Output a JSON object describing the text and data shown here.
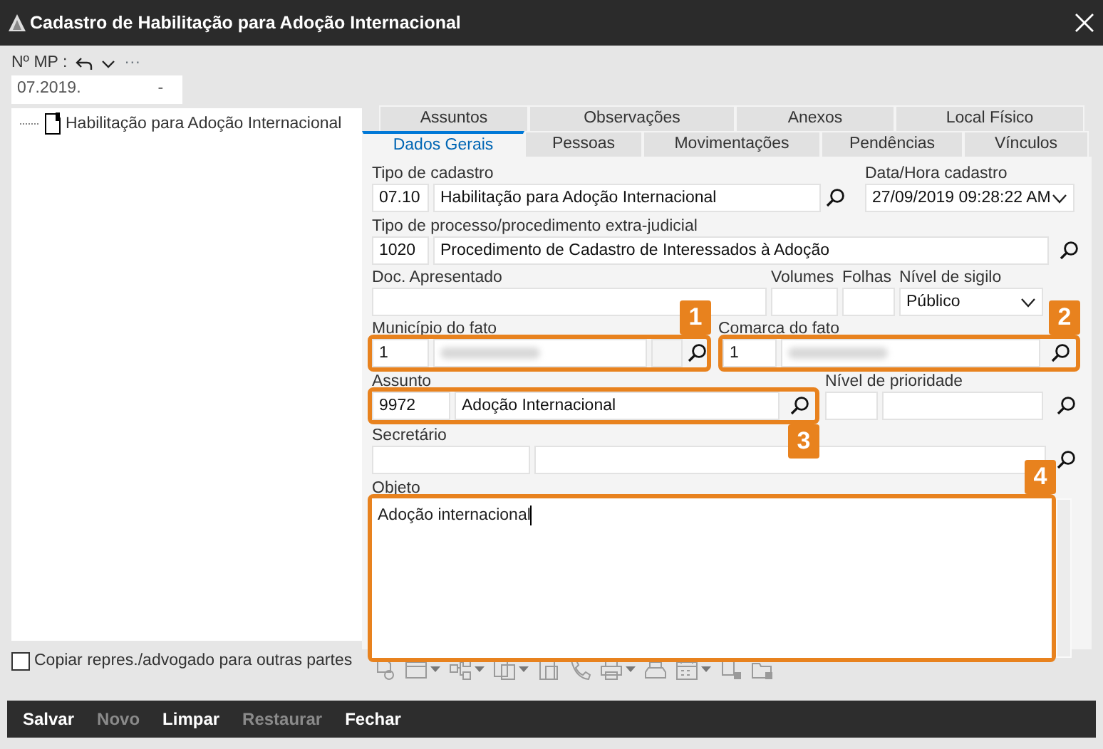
{
  "window": {
    "title": "Cadastro de Habilitação para Adoção Internacional"
  },
  "mp": {
    "label": "Nº MP :",
    "value": "07.2019.",
    "suffix": "-",
    "more": "···"
  },
  "tree": [
    {
      "label": "Habilitação para Adoção Internacional"
    }
  ],
  "copy_option": {
    "label": "Copiar repres./advogado para outras partes",
    "checked": false
  },
  "tabs": [
    [
      {
        "label": "Assuntos",
        "selected": false
      },
      {
        "label": "Observações",
        "selected": false
      },
      {
        "label": "Anexos",
        "selected": false
      },
      {
        "label": "Local Físico",
        "selected": false
      }
    ],
    [
      {
        "label": "Dados Gerais",
        "selected": true
      },
      {
        "label": "Pessoas",
        "selected": false
      },
      {
        "label": "Movimentações",
        "selected": false
      },
      {
        "label": "Pendências",
        "selected": false
      },
      {
        "label": "Vínculos",
        "selected": false
      }
    ]
  ],
  "form": {
    "tipo_cadastro": {
      "label": "Tipo de cadastro",
      "code": "07.10",
      "name": "Habilitação para Adoção Internacional"
    },
    "data_hora": {
      "label": "Data/Hora cadastro",
      "value": "27/09/2019 09:28:22 AM"
    },
    "tipo_processo": {
      "label": "Tipo de processo/procedimento extra-judicial",
      "code": "1020",
      "name": "Procedimento de Cadastro de Interessados à Adoção"
    },
    "doc_apresentado": {
      "label": "Doc. Apresentado"
    },
    "volumes": {
      "label": "Volumes"
    },
    "folhas": {
      "label": "Folhas"
    },
    "nivel_sigilo": {
      "label": "Nível de sigilo",
      "value": "Público"
    },
    "municipio": {
      "label": "Município do fato",
      "code": "1",
      "callout": "1"
    },
    "comarca": {
      "label": "Comarca do fato",
      "code": "1",
      "callout": "2"
    },
    "assunto": {
      "label": "Assunto",
      "code": "9972",
      "name": "Adoção Internacional",
      "callout": "3"
    },
    "nivel_prioridade": {
      "label": "Nível de prioridade"
    },
    "secretario": {
      "label": "Secretário"
    },
    "objeto": {
      "label": "Objeto",
      "value": "Adoção internacional",
      "callout": "4"
    }
  },
  "actions": [
    {
      "label": "Salvar",
      "disabled": false
    },
    {
      "label": "Novo",
      "disabled": true
    },
    {
      "label": "Limpar",
      "disabled": false
    },
    {
      "label": "Restaurar",
      "disabled": true
    },
    {
      "label": "Fechar",
      "disabled": false
    }
  ]
}
